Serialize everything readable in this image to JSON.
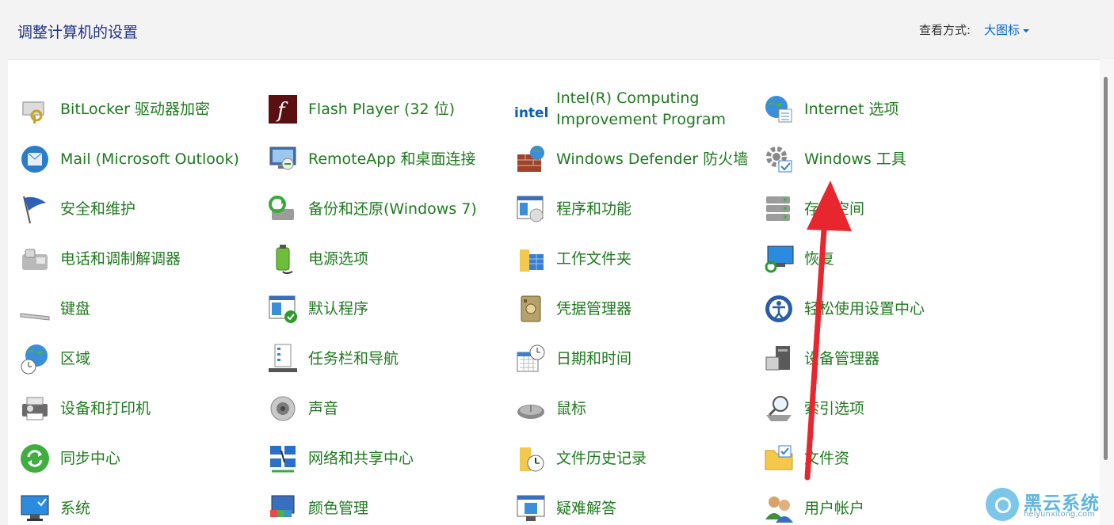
{
  "header": {
    "title": "调整计算机的设置",
    "view_by_label": "查看方式:",
    "view_by_value": "大图标"
  },
  "items": [
    {
      "label": "BitLocker 驱动器加密",
      "icon": "bitlocker-icon"
    },
    {
      "label": "Flash Player (32 位)",
      "icon": "flash-player-icon"
    },
    {
      "label": "Intel(R) Computing Improvement Program",
      "icon": "intel-icon"
    },
    {
      "label": "Internet 选项",
      "icon": "internet-options-icon"
    },
    {
      "label": "Mail (Microsoft Outlook)",
      "icon": "mail-icon"
    },
    {
      "label": "RemoteApp 和桌面连接",
      "icon": "remoteapp-icon"
    },
    {
      "label": "Windows Defender 防火墙",
      "icon": "firewall-icon"
    },
    {
      "label": "Windows 工具",
      "icon": "windows-tools-icon"
    },
    {
      "label": "安全和维护",
      "icon": "flag-icon"
    },
    {
      "label": "备份和还原(Windows 7)",
      "icon": "backup-icon"
    },
    {
      "label": "程序和功能",
      "icon": "programs-icon"
    },
    {
      "label": "存储空间",
      "icon": "storage-icon"
    },
    {
      "label": "电话和调制解调器",
      "icon": "phone-modem-icon"
    },
    {
      "label": "电源选项",
      "icon": "power-icon"
    },
    {
      "label": "工作文件夹",
      "icon": "work-folders-icon"
    },
    {
      "label": "恢复",
      "icon": "recovery-icon"
    },
    {
      "label": "键盘",
      "icon": "keyboard-icon"
    },
    {
      "label": "默认程序",
      "icon": "default-programs-icon"
    },
    {
      "label": "凭据管理器",
      "icon": "credential-manager-icon"
    },
    {
      "label": "轻松使用设置中心",
      "icon": "ease-of-access-icon"
    },
    {
      "label": "区域",
      "icon": "region-icon"
    },
    {
      "label": "任务栏和导航",
      "icon": "taskbar-icon"
    },
    {
      "label": "日期和时间",
      "icon": "date-time-icon"
    },
    {
      "label": "设备管理器",
      "icon": "device-manager-icon"
    },
    {
      "label": "设备和打印机",
      "icon": "printer-icon"
    },
    {
      "label": "声音",
      "icon": "sound-icon"
    },
    {
      "label": "鼠标",
      "icon": "mouse-icon"
    },
    {
      "label": "索引选项",
      "icon": "indexing-icon"
    },
    {
      "label": "同步中心",
      "icon": "sync-center-icon"
    },
    {
      "label": "网络和共享中心",
      "icon": "network-icon"
    },
    {
      "label": "文件历史记录",
      "icon": "file-history-icon"
    },
    {
      "label": "文件资",
      "icon": "file-explorer-icon"
    },
    {
      "label": "系统",
      "icon": "system-icon"
    },
    {
      "label": "颜色管理",
      "icon": "color-management-icon"
    },
    {
      "label": "疑难解答",
      "icon": "troubleshooting-icon"
    },
    {
      "label": "用户帐户",
      "icon": "user-accounts-icon"
    }
  ],
  "watermark": {
    "title": "黑云系统",
    "url": "heiyunxitong.com"
  },
  "colors": {
    "link_green": "#1f7a1f",
    "title_blue": "#1e3287",
    "accent_blue": "#0066cc",
    "annotation_red": "#e8262d"
  }
}
